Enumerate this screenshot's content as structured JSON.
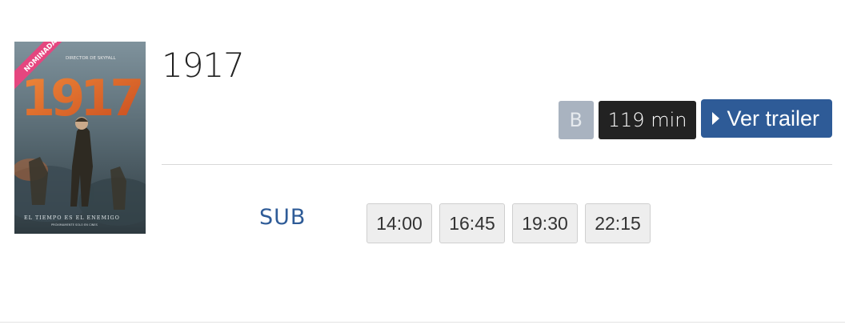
{
  "movie": {
    "title": "1917",
    "poster": {
      "badge_text": "NOMINADA",
      "director_line": "DIRECTOR DE SKYFALL",
      "big_title": "1917",
      "tagline": "EL TIEMPO ES EL ENEMIGO",
      "release_line": "PRÓXIMAMENTE SOLO EN CINES"
    },
    "rating": "B",
    "duration": "119 min",
    "trailer_label": "Ver trailer"
  },
  "showings": {
    "format": "SUB",
    "times": [
      "14:00",
      "16:45",
      "19:30",
      "22:15"
    ]
  },
  "colors": {
    "accent": "#2e5b97",
    "duration_bg": "#222222",
    "rating_bg": "#a9b3c0",
    "time_bg": "#eeeeee"
  }
}
